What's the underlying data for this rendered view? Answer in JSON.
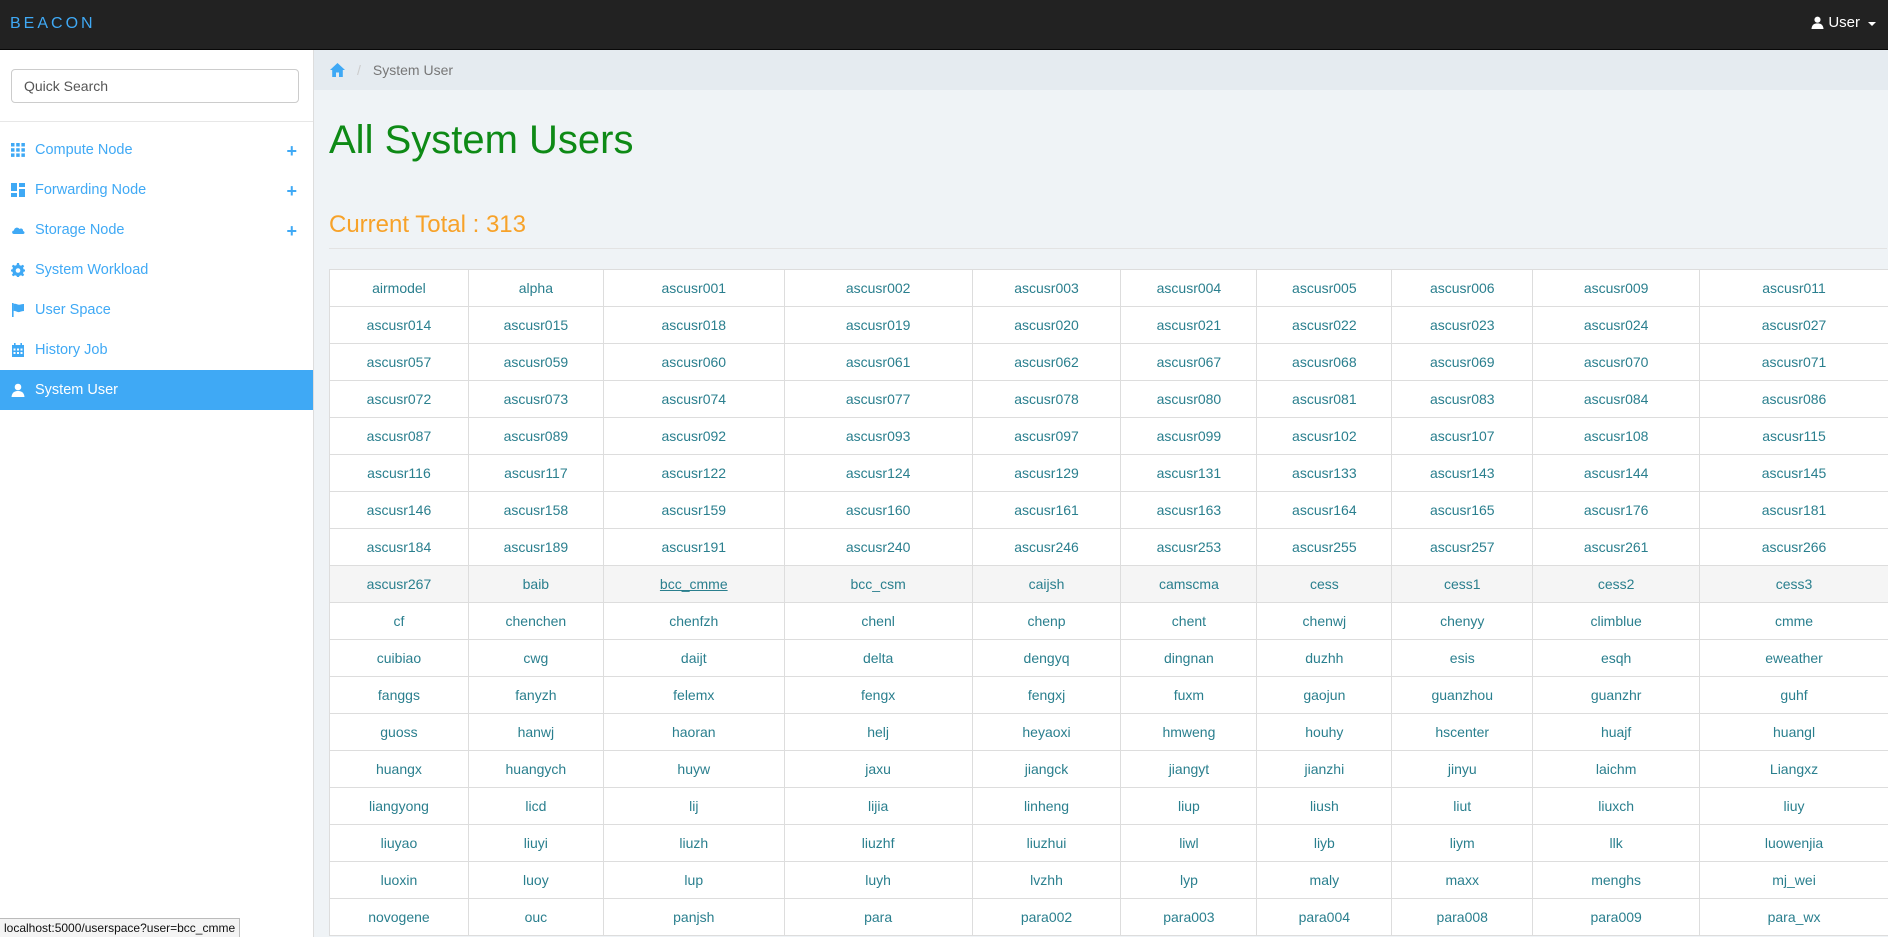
{
  "app": {
    "brand": "BEACON",
    "user_label": "User"
  },
  "sidebar": {
    "search_placeholder": "Quick Search",
    "items": [
      {
        "label": "Compute Node",
        "icon": "grid-icon",
        "expandable": true
      },
      {
        "label": "Forwarding Node",
        "icon": "dashboard-icon",
        "expandable": true
      },
      {
        "label": "Storage Node",
        "icon": "cloud-icon",
        "expandable": true
      },
      {
        "label": "System Workload",
        "icon": "gear-icon",
        "expandable": false
      },
      {
        "label": "User Space",
        "icon": "flag-icon",
        "expandable": false
      },
      {
        "label": "History Job",
        "icon": "calendar-icon",
        "expandable": false
      },
      {
        "label": "System User",
        "icon": "user-icon",
        "expandable": false,
        "active": true
      }
    ],
    "plus_symbol": "+"
  },
  "breadcrumb": {
    "current": "System User",
    "separator": "/"
  },
  "main": {
    "title": "All System Users",
    "total_text": "Current Total : 313"
  },
  "users_table": {
    "rows": [
      [
        "airmodel",
        "alpha",
        "ascusr001",
        "ascusr002",
        "ascusr003",
        "ascusr004",
        "ascusr005",
        "ascusr006",
        "ascusr009",
        "ascusr011"
      ],
      [
        "ascusr014",
        "ascusr015",
        "ascusr018",
        "ascusr019",
        "ascusr020",
        "ascusr021",
        "ascusr022",
        "ascusr023",
        "ascusr024",
        "ascusr027"
      ],
      [
        "ascusr057",
        "ascusr059",
        "ascusr060",
        "ascusr061",
        "ascusr062",
        "ascusr067",
        "ascusr068",
        "ascusr069",
        "ascusr070",
        "ascusr071"
      ],
      [
        "ascusr072",
        "ascusr073",
        "ascusr074",
        "ascusr077",
        "ascusr078",
        "ascusr080",
        "ascusr081",
        "ascusr083",
        "ascusr084",
        "ascusr086"
      ],
      [
        "ascusr087",
        "ascusr089",
        "ascusr092",
        "ascusr093",
        "ascusr097",
        "ascusr099",
        "ascusr102",
        "ascusr107",
        "ascusr108",
        "ascusr115"
      ],
      [
        "ascusr116",
        "ascusr117",
        "ascusr122",
        "ascusr124",
        "ascusr129",
        "ascusr131",
        "ascusr133",
        "ascusr143",
        "ascusr144",
        "ascusr145"
      ],
      [
        "ascusr146",
        "ascusr158",
        "ascusr159",
        "ascusr160",
        "ascusr161",
        "ascusr163",
        "ascusr164",
        "ascusr165",
        "ascusr176",
        "ascusr181"
      ],
      [
        "ascusr184",
        "ascusr189",
        "ascusr191",
        "ascusr240",
        "ascusr246",
        "ascusr253",
        "ascusr255",
        "ascusr257",
        "ascusr261",
        "ascusr266"
      ],
      [
        "ascusr267",
        "baib",
        "bcc_cmme",
        "bcc_csm",
        "caijsh",
        "camscma",
        "cess",
        "cess1",
        "cess2",
        "cess3"
      ],
      [
        "cf",
        "chenchen",
        "chenfzh",
        "chenl",
        "chenp",
        "chent",
        "chenwj",
        "chenyy",
        "climblue",
        "cmme"
      ],
      [
        "cuibiao",
        "cwg",
        "daijt",
        "delta",
        "dengyq",
        "dingnan",
        "duzhh",
        "esis",
        "esqh",
        "eweather"
      ],
      [
        "fanggs",
        "fanyzh",
        "felemx",
        "fengx",
        "fengxj",
        "fuxm",
        "gaojun",
        "guanzhou",
        "guanzhr",
        "guhf"
      ],
      [
        "guoss",
        "hanwj",
        "haoran",
        "helj",
        "heyaoxi",
        "hmweng",
        "houhy",
        "hscenter",
        "huajf",
        "huangl"
      ],
      [
        "huangx",
        "huangych",
        "huyw",
        "jaxu",
        "jiangck",
        "jiangyt",
        "jianzhi",
        "jinyu",
        "laichm",
        "Liangxz"
      ],
      [
        "liangyong",
        "licd",
        "lij",
        "lijia",
        "linheng",
        "liup",
        "liush",
        "liut",
        "liuxch",
        "liuy"
      ],
      [
        "liuyao",
        "liuyi",
        "liuzh",
        "liuzhf",
        "liuzhui",
        "liwl",
        "liyb",
        "liym",
        "llk",
        "luowenjia"
      ],
      [
        "luoxin",
        "luoy",
        "lup",
        "luyh",
        "lvzhh",
        "lyp",
        "maly",
        "maxx",
        "menghs",
        "mj_wei"
      ],
      [
        "novogene",
        "ouc",
        "panjsh",
        "para",
        "para002",
        "para003",
        "para004",
        "para008",
        "para009",
        "para_wx"
      ]
    ],
    "hover_row": 8,
    "underlined_cell": [
      8,
      2
    ]
  },
  "statusbar": {
    "url": "localhost:5000/userspace?user=bcc_cmme"
  },
  "colors": {
    "accent": "#3fa9f5",
    "title": "#0e8a16",
    "total": "#f7a229",
    "cell_text": "#2a7f8e",
    "navbar": "#222222"
  }
}
